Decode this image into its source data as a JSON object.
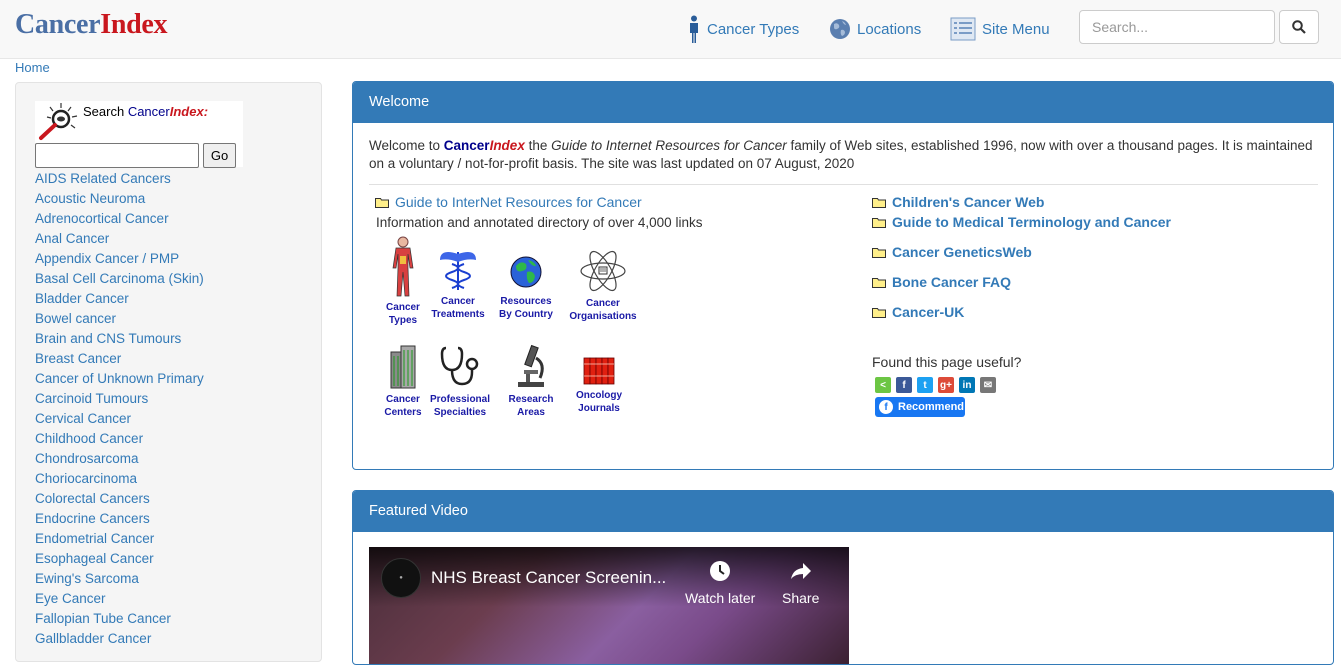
{
  "header": {
    "logo_part1": "Cancer",
    "logo_part2": "Index",
    "nav": [
      {
        "label": "Cancer Types",
        "icon": "person-icon"
      },
      {
        "label": "Locations",
        "icon": "globe-icon"
      },
      {
        "label": "Site Menu",
        "icon": "list-icon"
      }
    ],
    "search_placeholder": "Search...",
    "search_icon": "magnifier-icon"
  },
  "breadcrumb": "Home",
  "sidebar": {
    "search_label_prefix": "Search ",
    "search_label_cancer": "Cancer",
    "search_label_index": "Index:",
    "go_label": "Go",
    "items": [
      "AIDS Related Cancers",
      "Acoustic Neuroma",
      "Adrenocortical Cancer",
      "Anal Cancer",
      "Appendix Cancer / PMP",
      "Basal Cell Carcinoma (Skin)",
      "Bladder Cancer",
      "Bowel cancer",
      "Brain and CNS Tumours",
      "Breast Cancer",
      "Cancer of Unknown Primary",
      "Carcinoid Tumours",
      "Cervical Cancer",
      "Childhood Cancer",
      "Chondrosarcoma",
      "Choriocarcinoma",
      "Colorectal Cancers",
      "Endocrine Cancers",
      "Endometrial Cancer",
      "Esophageal Cancer",
      "Ewing's Sarcoma",
      "Eye Cancer",
      "Fallopian Tube Cancer",
      "Gallbladder Cancer"
    ]
  },
  "welcome": {
    "heading": "Welcome",
    "intro_prefix": "Welcome to ",
    "intro_cancer": "Cancer",
    "intro_index": "Index",
    "intro_the": " the ",
    "intro_guide": "Guide to Internet Resources for Cancer",
    "intro_rest": " family of Web sites, established 1996, now with over a thousand pages. It is maintained on a voluntary / not-for-profit basis. The site was last updated on 07 August, 2020",
    "guide_link": "Guide to InterNet Resources for Cancer",
    "guide_desc": "Information and annotated directory of over 4,000 links",
    "icons": [
      {
        "line1": "Cancer",
        "line2": "Types",
        "icon": "body-icon"
      },
      {
        "line1": "Cancer",
        "line2": "Treatments",
        "icon": "caduceus-icon"
      },
      {
        "line1": "Resources",
        "line2": "By Country",
        "icon": "globe-icon"
      },
      {
        "line1": "Cancer",
        "line2": "Organisations",
        "icon": "atom-icon"
      },
      {
        "line1": "Cancer",
        "line2": "Centers",
        "icon": "building-icon"
      },
      {
        "line1": "Professional",
        "line2": "Specialties",
        "icon": "stethoscope-icon"
      },
      {
        "line1": "Research",
        "line2": "Areas",
        "icon": "microscope-icon"
      },
      {
        "line1": "Oncology",
        "line2": "Journals",
        "icon": "journals-icon"
      }
    ],
    "right_links": [
      "Children's Cancer Web",
      "Guide to Medical Terminology and Cancer",
      "Cancer GeneticsWeb",
      "Bone Cancer FAQ",
      "Cancer-UK"
    ],
    "found_useful": "Found this page useful?",
    "recommend_label": "Recommend",
    "share_colors": {
      "share": "#6cc644",
      "facebook": "#3b5998",
      "twitter": "#1da1f2",
      "googleplus": "#dd4b39",
      "linkedin": "#0077b5",
      "email": "#777777"
    }
  },
  "featured": {
    "heading": "Featured Video",
    "video_title": "NHS Breast Cancer Screenin...",
    "watch_later": "Watch later",
    "share": "Share"
  },
  "colors": {
    "primary": "#337ab7",
    "brand_red": "#c9171e"
  }
}
